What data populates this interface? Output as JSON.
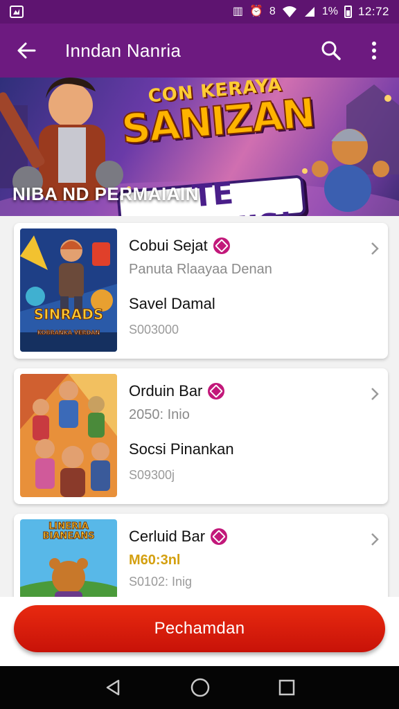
{
  "status_bar": {
    "time": "12:72",
    "battery_text": "1%",
    "icons": [
      "app-notification-icon",
      "vibrate-icon",
      "alarm-icon",
      "wifi-icon",
      "signal-icon",
      "battery-icon"
    ]
  },
  "app_bar": {
    "title": "Inndan Nanria",
    "icons": [
      "back-arrow-icon",
      "search-icon",
      "more-vert-icon"
    ]
  },
  "banner": {
    "headline_small": "CON KERAYA",
    "headline_big": "SANIZAN",
    "headline_sub": "TE RYAANIS!",
    "caption": "NIBA ND PERMAIAIN"
  },
  "items": [
    {
      "title": "Cobui Sejat",
      "subtitle": "Panuta Rlaayaa Denan",
      "name": "Savel Damal",
      "value": "S003000",
      "thumb_label": "SINRADS",
      "thumb_sub": "KOBRANKA VERDAN"
    },
    {
      "title": "Orduin Bar",
      "subtitle": "2050: Inio",
      "name": "Socsi Pinankan",
      "value": "S09300j",
      "thumb_label": "",
      "thumb_sub": ""
    },
    {
      "title": "Cerluid Bar",
      "subtitle": "M60:3nl",
      "name": "",
      "value": "S0102: Inig",
      "thumb_label": "LINERIA BIANEANS",
      "thumb_sub": ""
    }
  ],
  "primary_button": {
    "label": "Pechamdan"
  },
  "nav": {
    "icons": [
      "nav-back-icon",
      "nav-home-icon",
      "nav-recents-icon"
    ]
  },
  "colors": {
    "status_bar": "#5e1470",
    "app_bar": "#6d1a80",
    "accent_badge": "#c2187a",
    "primary_button": "#d81c0c",
    "nav_bar": "#050505"
  }
}
